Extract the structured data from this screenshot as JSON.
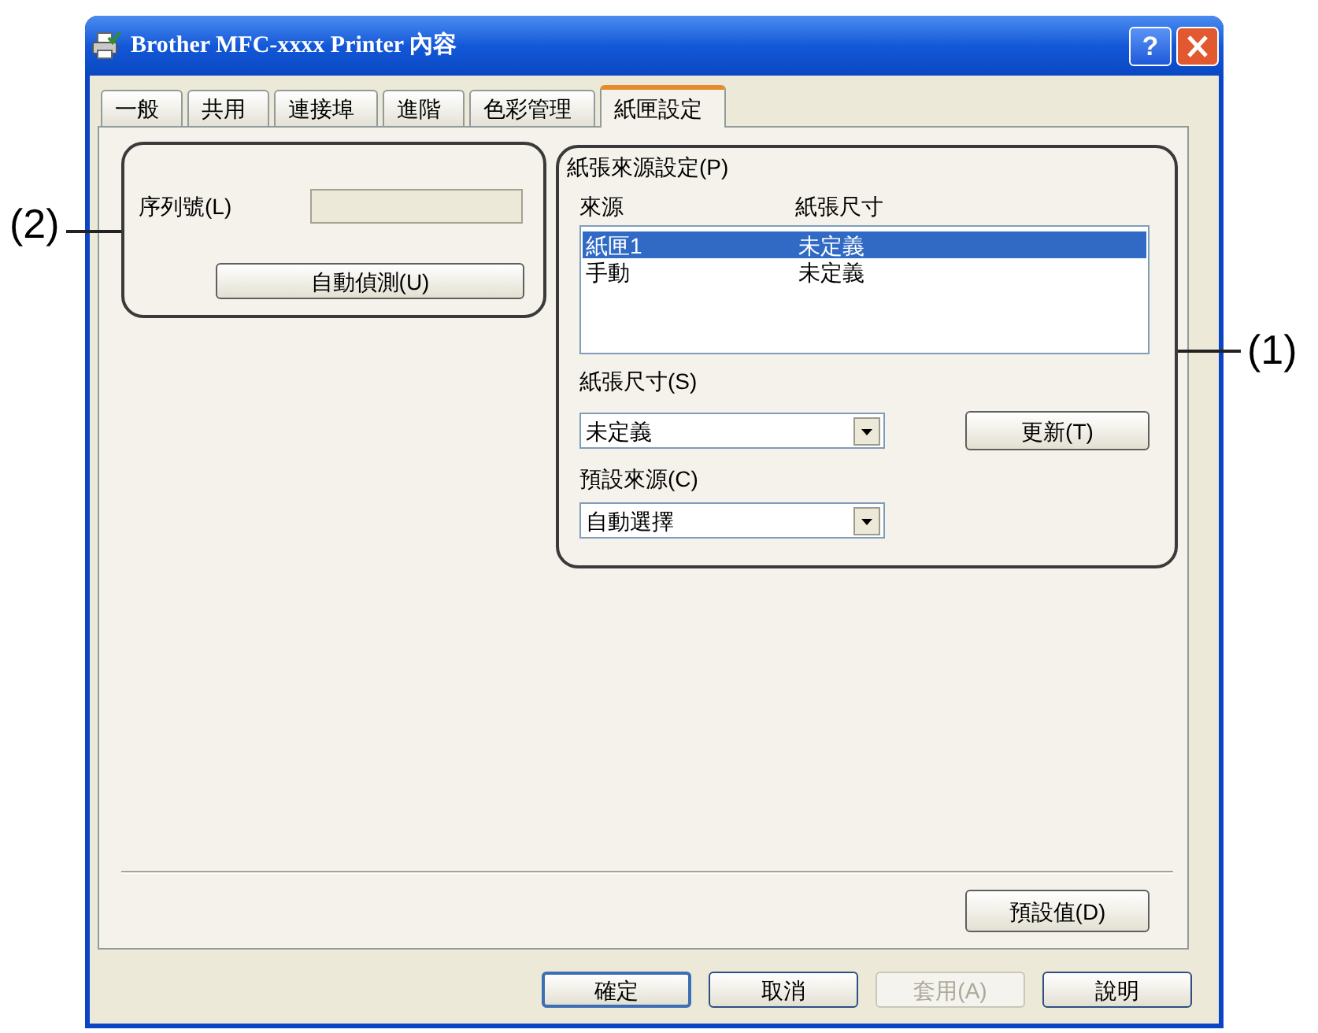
{
  "window": {
    "title": "Brother MFC-xxxx Printer 內容",
    "help_button": "?"
  },
  "tabs": [
    {
      "label": "一般",
      "selected": false
    },
    {
      "label": "共用",
      "selected": false
    },
    {
      "label": "連接埠",
      "selected": false
    },
    {
      "label": "進階",
      "selected": false
    },
    {
      "label": "色彩管理",
      "selected": false
    },
    {
      "label": "紙匣設定",
      "selected": true
    }
  ],
  "serial_group": {
    "callout": "(2)",
    "label": "序列號(L)",
    "field": {
      "disabled": true
    },
    "auto_detect_button": "自動偵測(U)"
  },
  "paper_source_group": {
    "callout": "(1)",
    "title": "紙張來源設定(P)",
    "columns": [
      "來源",
      "紙張尺寸"
    ],
    "rows": [
      {
        "source": "紙匣1",
        "paper_size": "未定義",
        "selected": true
      },
      {
        "source": "手動",
        "paper_size": "未定義",
        "selected": false
      }
    ],
    "paper_size_label": "紙張尺寸(S)",
    "paper_size_select": "未定義",
    "update_button": "更新(T)",
    "default_source_label": "預設來源(C)",
    "default_source_select": "自動選擇"
  },
  "defaults_button": "預設值(D)",
  "buttons": [
    {
      "label": "確定",
      "default": true,
      "disabled": false
    },
    {
      "label": "取消",
      "default": false,
      "disabled": false
    },
    {
      "label": "套用(A)",
      "default": false,
      "disabled": true
    },
    {
      "label": "說明",
      "default": false,
      "disabled": false
    }
  ]
}
